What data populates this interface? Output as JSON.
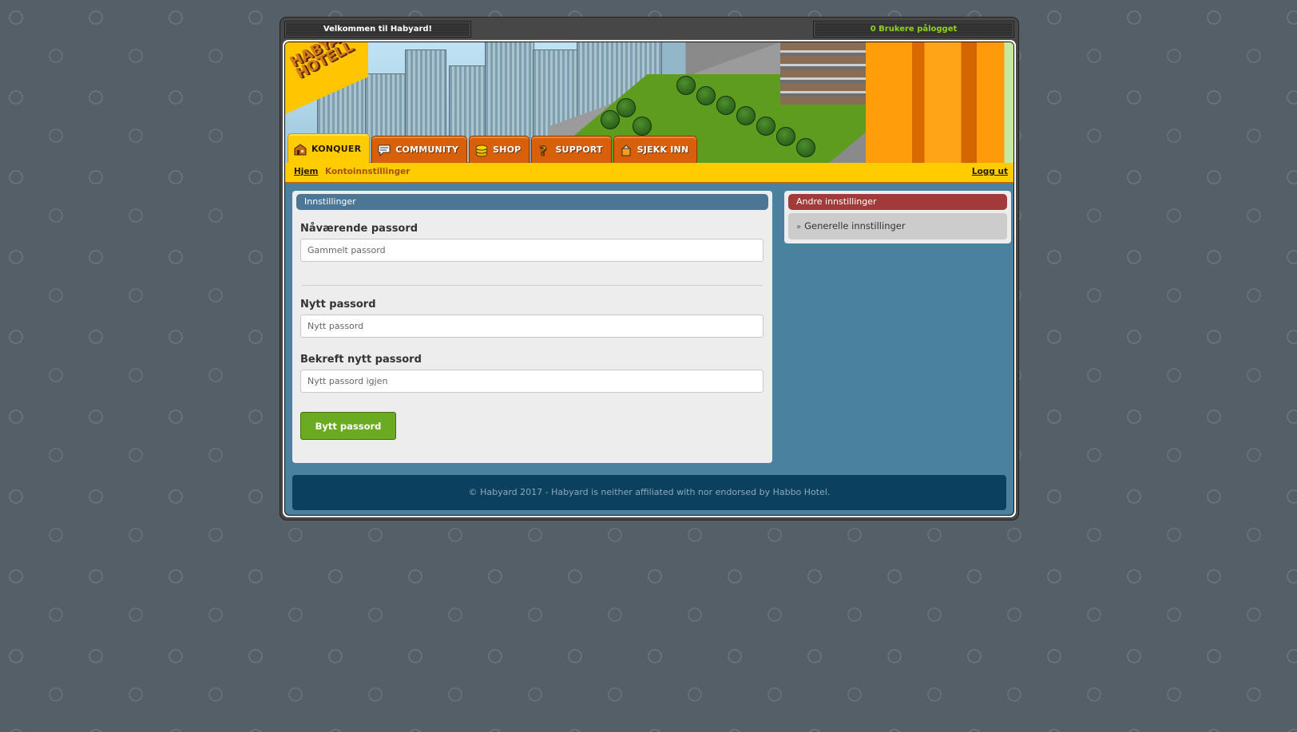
{
  "topbar": {
    "welcome": "Velkommen til Habyard!",
    "online": "0 Brukere pålogget"
  },
  "brand": {
    "logo_line1": "HABYARD",
    "logo_line2": "HOTELL"
  },
  "nav": {
    "tabs": [
      {
        "label": "KONQUER",
        "icon": "house-icon",
        "active": true
      },
      {
        "label": "COMMUNITY",
        "icon": "speech-bubble-icon",
        "active": false
      },
      {
        "label": "SHOP",
        "icon": "coins-icon",
        "active": false
      },
      {
        "label": "SUPPORT",
        "icon": "question-mark-icon",
        "active": false
      },
      {
        "label": "SJEKK INN",
        "icon": "cake-box-icon",
        "active": false
      }
    ]
  },
  "subnav": {
    "home": "Hjem",
    "current": "Kontoinnstillinger",
    "logout": "Logg ut"
  },
  "settings_panel": {
    "title": "Innstillinger",
    "current_password": {
      "label": "Nåværende passord",
      "placeholder": "Gammelt passord",
      "value": ""
    },
    "new_password": {
      "label": "Nytt passord",
      "placeholder": "Nytt passord",
      "value": ""
    },
    "confirm_password": {
      "label": "Bekreft nytt passord",
      "placeholder": "Nytt passord igjen",
      "value": ""
    },
    "submit_label": "Bytt passord"
  },
  "other_settings": {
    "title": "Andre innstillinger",
    "items": [
      {
        "prefix": "»",
        "label": "Generelle innstillinger"
      }
    ]
  },
  "footer": {
    "text": "© Habyard 2017 - Habyard is neither affiliated with nor endorsed by Habbo Hotel."
  },
  "colors": {
    "tab_active": "#ffcc00",
    "tab_inactive": "#d9600a",
    "panel_head_blue": "#4b7695",
    "panel_head_red": "#a33a3a",
    "button_green": "#6aab22",
    "online_text": "#8fd21f",
    "footer_bg": "#0b405f"
  }
}
